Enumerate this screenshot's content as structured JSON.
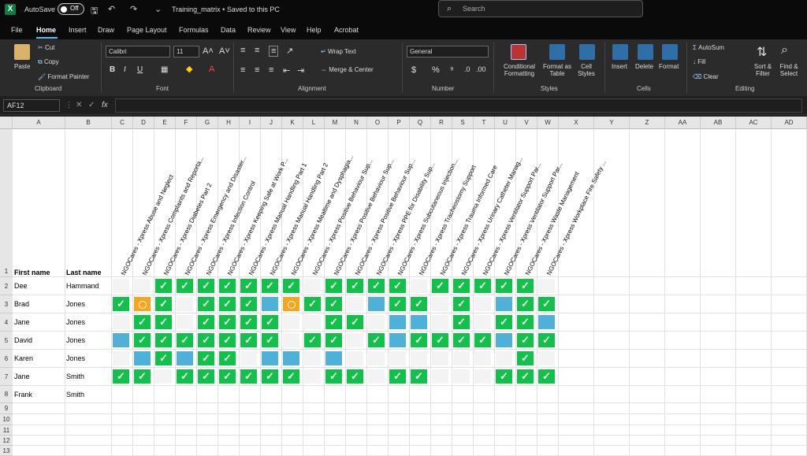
{
  "titlebar": {
    "autosave_label": "AutoSave",
    "autosave_state": "Off",
    "doc_title": "Training_matrix • Saved to this PC",
    "search_placeholder": "Search"
  },
  "menu": [
    "File",
    "Home",
    "Insert",
    "Draw",
    "Page Layout",
    "Formulas",
    "Data",
    "Review",
    "View",
    "Help",
    "Acrobat"
  ],
  "ribbon": {
    "clipboard": {
      "paste": "Paste",
      "cut": "Cut",
      "copy": "Copy",
      "format_painter": "Format Painter",
      "label": "Clipboard"
    },
    "font": {
      "name": "Calibri",
      "size": "11",
      "label": "Font"
    },
    "alignment": {
      "wrap": "Wrap Text",
      "merge": "Merge & Center",
      "label": "Alignment"
    },
    "number": {
      "format": "General",
      "label": "Number"
    },
    "styles": {
      "conditional": "Conditional Formatting",
      "format_table": "Format as Table",
      "cell_styles": "Cell Styles",
      "label": "Styles"
    },
    "cells": {
      "insert": "Insert",
      "delete": "Delete",
      "format": "Format",
      "label": "Cells"
    },
    "editing": {
      "autosum": "AutoSum",
      "fill": "Fill",
      "clear": "Clear",
      "sort": "Sort & Filter",
      "find": "Find & Select",
      "label": "Editing"
    }
  },
  "formula_bar": {
    "name_box": "AF12",
    "fx": "fx"
  },
  "columns": [
    "A",
    "B",
    "C",
    "D",
    "E",
    "F",
    "G",
    "H",
    "I",
    "J",
    "K",
    "L",
    "M",
    "N",
    "O",
    "P",
    "Q",
    "R",
    "S",
    "T",
    "U",
    "V",
    "W",
    "X",
    "Y",
    "Z",
    "AA",
    "AB",
    "AC",
    "AD"
  ],
  "rows": [
    "1",
    "2",
    "3",
    "4",
    "5",
    "6",
    "7",
    "8",
    "9",
    "10",
    "11",
    "12",
    "13"
  ],
  "sheet": {
    "first_name_header": "First name",
    "last_name_header": "Last name",
    "courses": [
      "NGOCares - Xpress Abuse and Neglect",
      "NGOCares - Xpress Complaints and Reporta...",
      "NGOCares - Xpress Diabetes Part 2",
      "NGOCares - Xpress Emergency and Disaster...",
      "NGOCares - Xpress Infection Control",
      "NGOCares - Xpress Keeping Safe at Work P...",
      "NGOCares - Xpress Manual Handling Part 1",
      "NGOCares - Xpress Manual Handling Part 2",
      "NGOCares - Xpress Mealtime and Dysphagia...",
      "NGOCares - Xpress Positive Behaviour Sup...",
      "NGOCares - Xpress Positive Behaviour Sup...",
      "NGOCares - Xpress Positive Behaviour Sup...",
      "NGOCares - Xpress PPE for Disability Sup...",
      "NGOCares - Xpress Subcutaneous Injection...",
      "NGOCares - Xpress Tracheostomy Support",
      "NGOCares - Xpress Trauma Informed Care",
      "NGOCares - Xpress Urinary Catheter Manag...",
      "NGOCares - Xpress Ventilator Support Par...",
      "NGOCares - Xpress Ventilator Support Par...",
      "NGOCares - Xpress Waste Management",
      "NGOCares - Xpress Workplace Fire Safety ..."
    ],
    "people": [
      {
        "first": "Dee",
        "last": "Hammand",
        "status": [
          "e",
          "e",
          "g",
          "g",
          "g",
          "g",
          "g",
          "g",
          "g",
          "e",
          "g",
          "g",
          "g",
          "g",
          "e",
          "g",
          "g",
          "g",
          "g",
          "g",
          "e"
        ]
      },
      {
        "first": "Brad",
        "last": "Jones",
        "status": [
          "g",
          "o",
          "g",
          "e",
          "g",
          "g",
          "g",
          "b",
          "o",
          "g",
          "g",
          "e",
          "b",
          "g",
          "g",
          "e",
          "g",
          "e",
          "b",
          "g",
          "g"
        ]
      },
      {
        "first": "Jane",
        "last": "Jones",
        "status": [
          "e",
          "g",
          "g",
          "e",
          "g",
          "g",
          "g",
          "g",
          "e",
          "e",
          "g",
          "g",
          "e",
          "b",
          "b",
          "e",
          "g",
          "e",
          "g",
          "g",
          "b"
        ]
      },
      {
        "first": "David",
        "last": "Jones",
        "status": [
          "b",
          "g",
          "g",
          "g",
          "g",
          "g",
          "g",
          "g",
          "e",
          "g",
          "g",
          "e",
          "g",
          "b",
          "g",
          "g",
          "g",
          "g",
          "b",
          "g",
          "g"
        ]
      },
      {
        "first": "Karen",
        "last": "Jones",
        "status": [
          "e",
          "b",
          "g",
          "b",
          "g",
          "g",
          "e",
          "b",
          "b",
          "e",
          "b",
          "e",
          "e",
          "e",
          "e",
          "e",
          "e",
          "e",
          "e",
          "g",
          "e"
        ]
      },
      {
        "first": "Jane",
        "last": "Smith",
        "status": [
          "g",
          "g",
          "e",
          "g",
          "g",
          "g",
          "g",
          "g",
          "g",
          "e",
          "g",
          "g",
          "e",
          "g",
          "g",
          "e",
          "e",
          "e",
          "g",
          "g",
          "g"
        ]
      },
      {
        "first": "Frank",
        "last": "Smith",
        "status": [
          "e",
          "e",
          "e",
          "e",
          "e",
          "e",
          "e",
          "e",
          "e",
          "e",
          "e",
          "e",
          "e",
          "e",
          "e",
          "e",
          "e",
          "e",
          "e",
          "e",
          "e"
        ]
      }
    ],
    "check_glyph": "✓"
  },
  "colors": {
    "green": "#12c14a",
    "blue": "#4fb1d8",
    "orange": "#f7a51c",
    "empty": "#f3f3f3"
  }
}
